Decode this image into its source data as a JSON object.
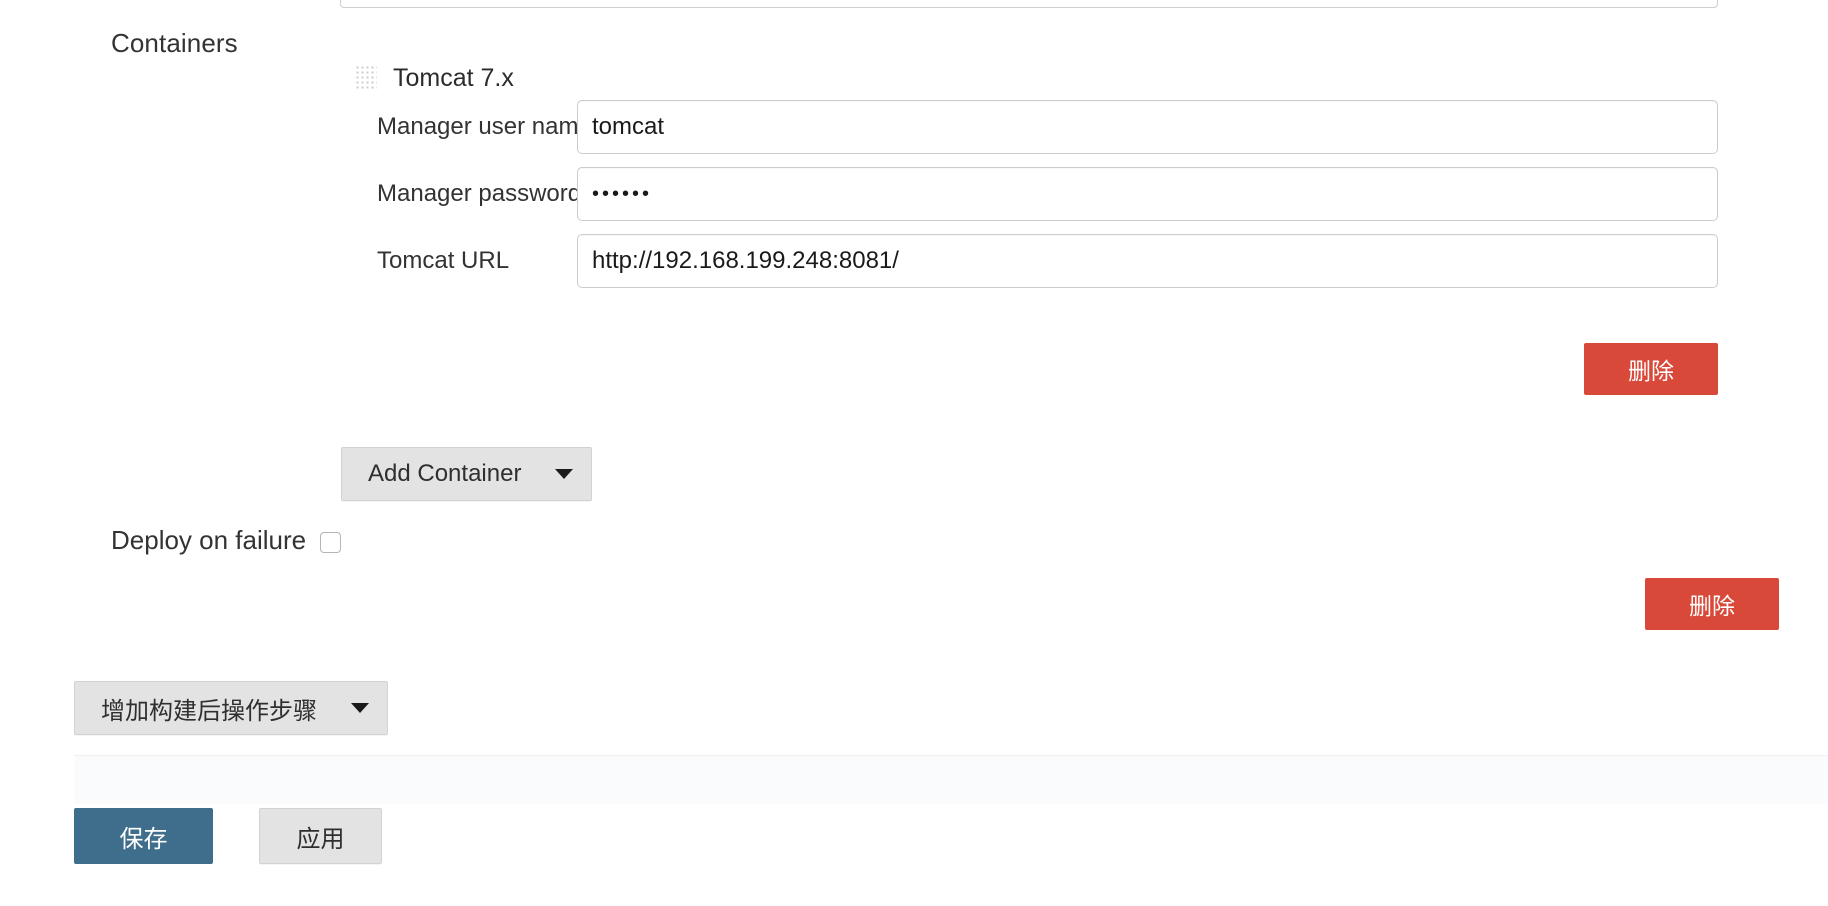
{
  "section": {
    "containers_label": "Containers"
  },
  "container": {
    "drag_handle_icon": "drag-grip-icon",
    "title": "Tomcat 7.x",
    "fields": [
      {
        "label": "Manager user name",
        "value": "tomcat",
        "type": "text",
        "placeholder": ""
      },
      {
        "label": "Manager password",
        "value": "••••••",
        "type": "password",
        "placeholder": ""
      },
      {
        "label": "Tomcat URL",
        "value": "http://192.168.199.248:8081/",
        "type": "text",
        "placeholder": ""
      }
    ],
    "delete_label": "删除",
    "add_container_label": "Add Container",
    "dropdown_icon": "caret-down-icon"
  },
  "publisher": {
    "deploy_on_failure_label": "Deploy on failure",
    "deploy_on_failure_checked": false,
    "delete_label": "删除"
  },
  "postbuild": {
    "add_step_label": "增加构建后操作步骤",
    "dropdown_icon": "caret-down-icon"
  },
  "actions": {
    "save_label": "保存",
    "apply_label": "应用"
  },
  "colors": {
    "danger": "#d9493a",
    "primary": "#3f6e8c",
    "button_grey": "#e3e3e3",
    "text": "#333333",
    "input_border": "#cccccc",
    "footer_bar": "#fafbfc"
  }
}
